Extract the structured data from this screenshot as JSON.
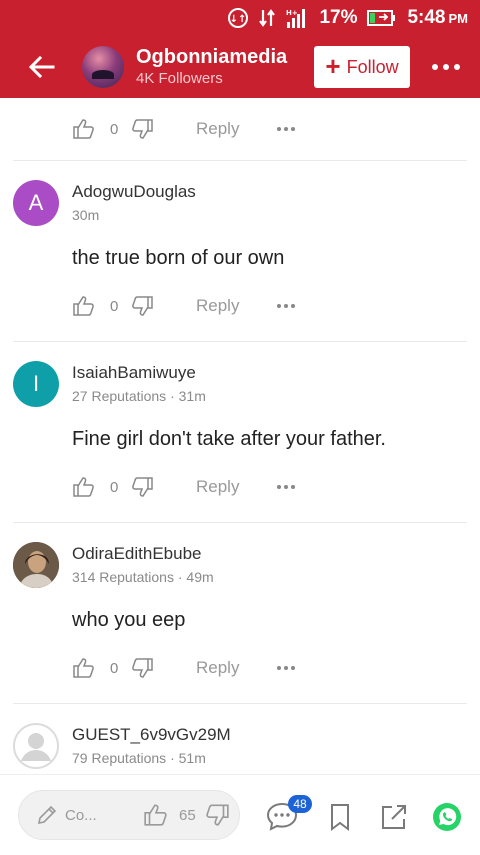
{
  "status_bar": {
    "battery_percent": "17%",
    "time": "5:48",
    "ampm": "PM"
  },
  "header": {
    "channel_name": "Ogbonniamedia",
    "followers": "4K Followers",
    "follow_label": "Follow"
  },
  "first_actions": {
    "likes": "0",
    "reply_label": "Reply"
  },
  "comments": [
    {
      "avatar_letter": "A",
      "avatar_color": "#a94cc6",
      "user": "AdogwuDouglas",
      "meta": "30m",
      "text": "the true born of our own",
      "likes": "0",
      "reply_label": "Reply"
    },
    {
      "avatar_letter": "I",
      "avatar_color": "#0f9fa8",
      "user": "IsaiahBamiwuye",
      "meta": "27 Reputations · 31m",
      "text": "Fine girl don't take after your father.",
      "likes": "0",
      "reply_label": "Reply"
    },
    {
      "avatar_letter": "",
      "avatar_color": "#5a4a3c",
      "user": "OdiraEdithEbube",
      "meta": "314 Reputations · 49m",
      "text": "who you eep",
      "likes": "0",
      "reply_label": "Reply"
    },
    {
      "avatar_letter": "",
      "avatar_color": "#d9d9d9",
      "user": "GUEST_6v9vGv29M",
      "meta": "79 Reputations · 51m",
      "text": "",
      "likes": "",
      "reply_label": ""
    }
  ],
  "bottom_bar": {
    "compose_placeholder": "Co...",
    "like_count": "65",
    "comment_badge": "48"
  },
  "colors": {
    "brand_red": "#c8202f",
    "badge_blue": "#1e63d6",
    "whatsapp_green": "#25d366"
  }
}
